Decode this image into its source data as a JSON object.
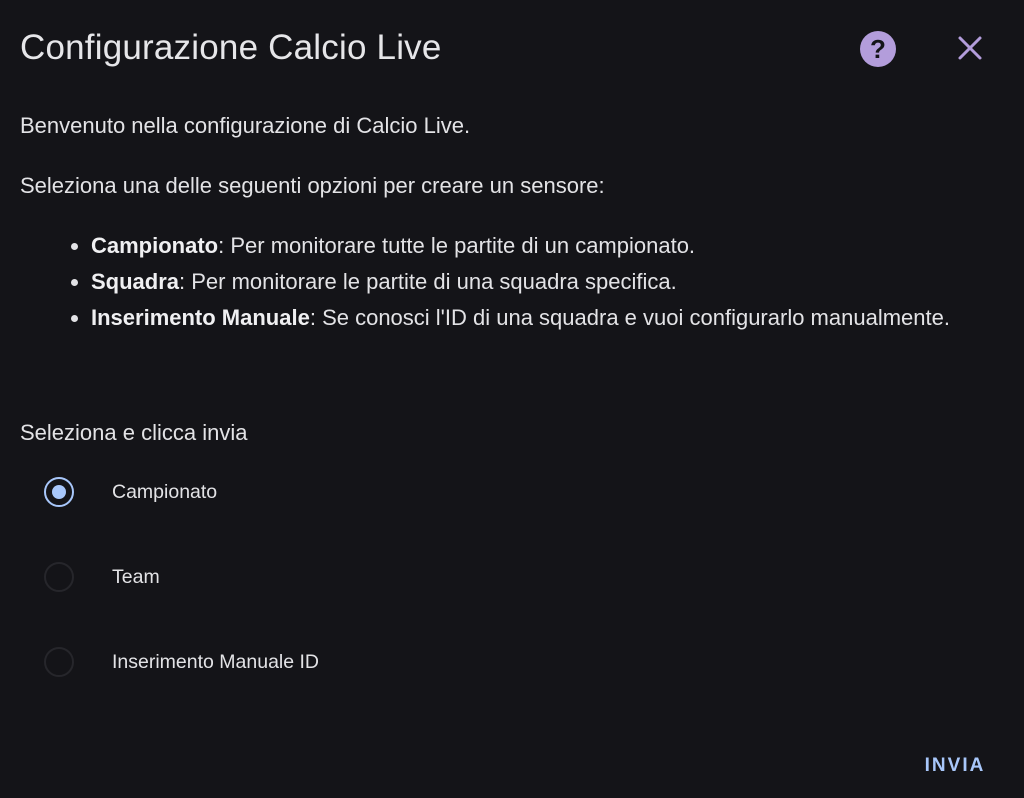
{
  "dialog": {
    "title": "Configurazione Calcio Live",
    "help_icon": "help-circle-icon",
    "close_icon": "close-icon",
    "accent_color": "#b39ddb",
    "primary_color": "#a8c7fa"
  },
  "description": {
    "welcome": "Benvenuto nella configurazione di Calcio Live.",
    "instruction": "Seleziona una delle seguenti opzioni per creare un sensore:",
    "options": [
      {
        "name": "Campionato",
        "text": ": Per monitorare tutte le partite di un campionato."
      },
      {
        "name": "Squadra",
        "text": ": Per monitorare le partite di una squadra specifica."
      },
      {
        "name": "Inserimento Manuale",
        "text": ": Se conosci l'ID di una squadra e vuoi configurarlo manualmente."
      }
    ]
  },
  "form": {
    "label": "Seleziona e clicca invia",
    "choices": [
      {
        "label": "Campionato",
        "checked": true
      },
      {
        "label": "Team",
        "checked": false
      },
      {
        "label": "Inserimento Manuale ID",
        "checked": false
      }
    ],
    "selected": "Campionato"
  },
  "actions": {
    "submit_label": "INVIA"
  }
}
